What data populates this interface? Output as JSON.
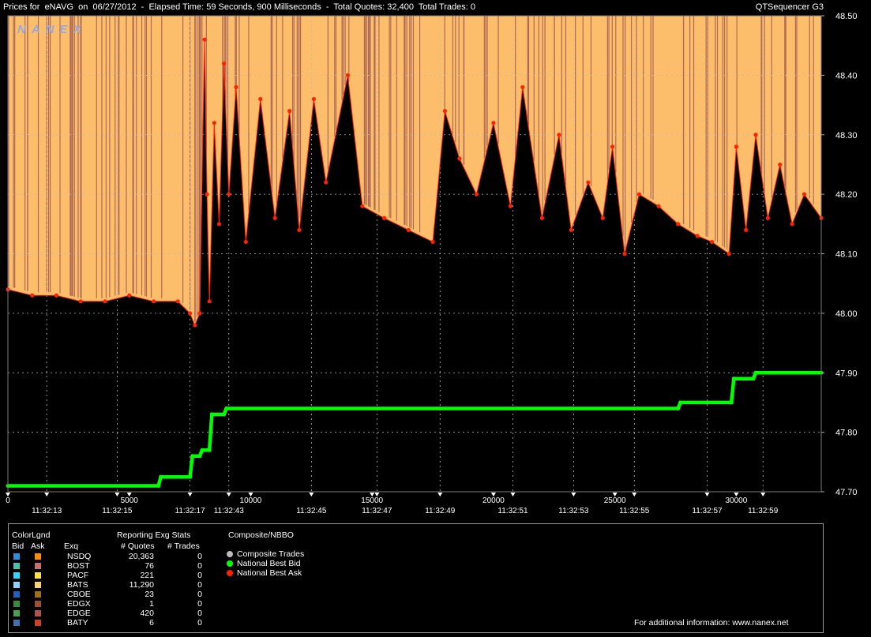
{
  "header": {
    "title": "Prices for  eNAVG  on  06/27/2012  -  Elapsed Time: 59 Seconds, 900 Milliseconds  -  Total Quotes: 32,400  Total Trades: 0",
    "app": "QTSequencer G3",
    "watermark": "NANEX"
  },
  "chart_data": {
    "type": "line",
    "title": "Prices for eNAVG on 06/27/2012",
    "ylim": [
      47.7,
      48.5
    ],
    "xlim": [
      0,
      33500
    ],
    "y_ticks": [
      "48.50",
      "48.40",
      "48.30",
      "48.20",
      "48.10",
      "48.00",
      "47.90",
      "47.80",
      "47.70"
    ],
    "x_ticks": [
      {
        "v": 0,
        "label": "0"
      },
      {
        "v": 5000,
        "label": "5000"
      },
      {
        "v": 10000,
        "label": "10000"
      },
      {
        "v": 15000,
        "label": "15000"
      },
      {
        "v": 20000,
        "label": "20000"
      },
      {
        "v": 25000,
        "label": "25000"
      },
      {
        "v": 30000,
        "label": "30000"
      }
    ],
    "time_labels": [
      {
        "v": 1600,
        "label": "11:32:13"
      },
      {
        "v": 4500,
        "label": "11:32:15"
      },
      {
        "v": 7500,
        "label": "11:32:17"
      },
      {
        "v": 9100,
        "label": "11:32:43"
      },
      {
        "v": 12500,
        "label": "11:32:45"
      },
      {
        "v": 15200,
        "label": "11:32:47"
      },
      {
        "v": 17800,
        "label": "11:32:49"
      },
      {
        "v": 20800,
        "label": "11:32:51"
      },
      {
        "v": 23300,
        "label": "11:32:53"
      },
      {
        "v": 25800,
        "label": "11:32:55"
      },
      {
        "v": 28800,
        "label": "11:32:57"
      },
      {
        "v": 31100,
        "label": "11:32:59"
      }
    ],
    "grid": true,
    "series": [
      {
        "name": "National Best Ask",
        "color": "#ff2200",
        "x": [
          0,
          1000,
          2000,
          3000,
          4000,
          5000,
          6000,
          7000,
          7500,
          7700,
          7900,
          8100,
          8200,
          8300,
          8500,
          8700,
          8900,
          9100,
          9400,
          9800,
          10400,
          11000,
          11600,
          12000,
          12600,
          13100,
          14000,
          14600,
          15500,
          16500,
          17500,
          18000,
          18600,
          19300,
          20000,
          20700,
          21200,
          22000,
          22700,
          23200,
          23900,
          24500,
          24900,
          25400,
          26000,
          26800,
          27600,
          28400,
          29000,
          29700,
          30000,
          30400,
          30800,
          31300,
          31800,
          32300,
          32800,
          33500
        ],
        "y": [
          48.04,
          48.03,
          48.03,
          48.02,
          48.02,
          48.03,
          48.02,
          48.02,
          48.0,
          47.98,
          48.0,
          48.46,
          48.2,
          48.02,
          48.32,
          48.15,
          48.42,
          48.2,
          48.38,
          48.12,
          48.36,
          48.16,
          48.34,
          48.14,
          48.36,
          48.22,
          48.4,
          48.18,
          48.16,
          48.14,
          48.12,
          48.34,
          48.26,
          48.2,
          48.32,
          48.18,
          48.38,
          48.16,
          48.3,
          48.14,
          48.22,
          48.16,
          48.28,
          48.1,
          48.2,
          48.18,
          48.15,
          48.13,
          48.12,
          48.1,
          48.28,
          48.14,
          48.3,
          48.16,
          48.25,
          48.15,
          48.2,
          48.16
        ]
      },
      {
        "name": "National Best Bid",
        "color": "#00ff00",
        "x": [
          0,
          6200,
          6300,
          7500,
          7600,
          7900,
          8000,
          8300,
          8400,
          8900,
          9000,
          27600,
          27700,
          29800,
          29900,
          30700,
          30800,
          33500
        ],
        "y": [
          47.71,
          47.71,
          47.725,
          47.725,
          47.76,
          47.76,
          47.77,
          47.77,
          47.83,
          47.83,
          47.84,
          47.84,
          47.85,
          47.85,
          47.89,
          47.89,
          47.9,
          47.9
        ]
      }
    ]
  },
  "legend": {
    "color_title": "ColorLgnd",
    "bid_header": "Bid",
    "ask_header": "Ask",
    "stats_title": "Reporting Exg Stats",
    "col_exg": "Exq",
    "col_quotes": "# Quotes",
    "col_trades": "# Trades",
    "rows": [
      {
        "exg": "NSDQ",
        "quotes": "20,363",
        "trades": "0",
        "bid": "#2f8fdc",
        "ask": "#ff8c00"
      },
      {
        "exg": "BOST",
        "quotes": "76",
        "trades": "0",
        "bid": "#49c0b0",
        "ask": "#c57070"
      },
      {
        "exg": "PACF",
        "quotes": "221",
        "trades": "0",
        "bid": "#2fd7ff",
        "ask": "#ffe040"
      },
      {
        "exg": "BATS",
        "quotes": "11,290",
        "trades": "0",
        "bid": "#8fd0ff",
        "ask": "#ffd070"
      },
      {
        "exg": "CBOE",
        "quotes": "23",
        "trades": "0",
        "bid": "#2060c0",
        "ask": "#a07010"
      },
      {
        "exg": "EDGX",
        "quotes": "1",
        "trades": "0",
        "bid": "#3a8a3a",
        "ask": "#a05030"
      },
      {
        "exg": "EDGE",
        "quotes": "420",
        "trades": "0",
        "bid": "#4aa04a",
        "ask": "#b05050"
      },
      {
        "exg": "BATY",
        "quotes": "6",
        "trades": "0",
        "bid": "#4070b0",
        "ask": "#d04020"
      }
    ],
    "composite_title": "Composite/NBBO",
    "composite_items": [
      {
        "label": "Composite Trades",
        "color": "#bbbbbb"
      },
      {
        "label": "National Best Bid",
        "color": "#00ff00"
      },
      {
        "label": "National Best Ask",
        "color": "#ff2200"
      }
    ],
    "footer": "For additional information: www.nanex.net"
  }
}
